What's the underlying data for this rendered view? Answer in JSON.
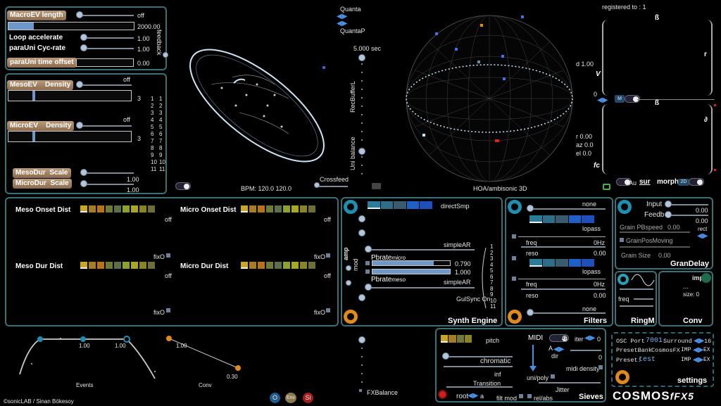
{
  "macro": {
    "length_label": "MacroEV length",
    "length_state": "off",
    "length_value": "2000.00",
    "loop_label": "Loop accelerate",
    "loop_value": "1.00",
    "para_label": "paraUni Cyc-rate",
    "para_value": "1.00",
    "offset_label": "paraUni time offset",
    "offset_value": "0.00",
    "feedback_label": "feedback"
  },
  "meso": {
    "meso_label": "MesoEV",
    "density_label": "Density",
    "meso_state": "off",
    "meso_value": "3",
    "micro_label": "MicroEV",
    "micro_state": "off",
    "micro_value": "3",
    "mesodur_label": "MesoDur",
    "microdur_label": "MicroDur",
    "scale_label": "Scale",
    "mesodur_value": "1.00",
    "microdur_value": "1.00",
    "numbers_a": [
      "1",
      "2",
      "3",
      "4",
      "5",
      "6",
      "7",
      "8",
      "9",
      "10",
      "11"
    ],
    "numbers_b": [
      "1",
      "2",
      "3",
      "4",
      "5",
      "6",
      "7",
      "8",
      "9",
      "10",
      "11"
    ]
  },
  "viz": {
    "bpm_text": "BPM: 120.0  120.0",
    "crossfeed_label": "Crossfeed",
    "quanta_label": "Quanta",
    "quantap_label": "QuantaP",
    "sec_label": "5.000 sec",
    "recbuffer_label": "RecBufferL",
    "unibalance_label": "Uni balance",
    "hoa_label": "HOA/ambisonic 3D"
  },
  "spatial": {
    "registered": "registered to : 1",
    "beta1": "ß",
    "r_label": "r",
    "d_label": "d 1.00",
    "v_label": "V",
    "zero": "0",
    "m_label": "M",
    "beta2": "ß",
    "partial": "∂",
    "r_val": "r 0.00",
    "az_val": "az 0.0",
    "el_val": "el 0.0",
    "fc_label": "fc",
    "au_label": "Au",
    "sur_label": "sur",
    "morph_label": "morph",
    "twod_label": "2D"
  },
  "onset": {
    "meso_onset": "Meso Onset Dist",
    "micro_onset": "Micro Onset Dist",
    "meso_dur": "Meso Dur  Dist",
    "micro_dur": "Micro Dur Dist",
    "off": "off",
    "fixo": "fixO",
    "colors": [
      "#c8a628",
      "#a67c26",
      "#b8721e",
      "#6e7a3a",
      "#5c6e4a",
      "#8ea030",
      "#a6a628",
      "#8a8428",
      "#6e6e3a"
    ]
  },
  "synth": {
    "title": "Synth Engine",
    "directsmp": "directSmp",
    "simplear1": "simpleAR",
    "simplear2": "simpleAR",
    "pbrate_micro": "Pbrate",
    "micro_sub": "micro",
    "pbrate_meso": "Pbrate",
    "meso_sub": "meso",
    "val1": "0.790",
    "val2": "1.000",
    "gulsync": "GulSync On",
    "amp": "amp",
    "mod": "mod",
    "numbers": [
      "1",
      "2",
      "3",
      "4",
      "5",
      "6",
      "7",
      "8",
      "9",
      "10",
      "11"
    ]
  },
  "filters": {
    "title": "Filters",
    "none1": "none",
    "lopass1": "lopass",
    "freq1": "freq",
    "hz1": "0Hz",
    "reso1": "reso",
    "reso1_val": "0.00",
    "lopass2": "lopass",
    "freq2": "freq",
    "hz2": "0Hz",
    "reso2": "reso",
    "reso2_val": "0.00",
    "none2": "none"
  },
  "grandelay": {
    "title": "GranDelay",
    "input": "Input",
    "input_val": "0.00",
    "feedb": "Feedb",
    "feedb_val": "0.00",
    "grainpb": "Grain PBspeed",
    "grainpb_val": "0.00",
    "rect": "rect",
    "grainpos": "GrainPosMoving",
    "grainsize": "Grain Size",
    "grainsize_val": "0.00"
  },
  "ringm": {
    "title": "RingM",
    "freq": "freq"
  },
  "conv": {
    "title": "Conv",
    "imp": "imp",
    "dots": "...",
    "size": "size: 0"
  },
  "pitch": {
    "pitch_label": "pitch",
    "chromatic": "chromatic",
    "inf": "inf",
    "transition": "Transition",
    "root": "root",
    "root_val": "a",
    "filtmod": "filt mod",
    "relabs": "rel/abs",
    "midi": "MIDI",
    "arp": "arp",
    "iter": "iter",
    "iter_val": "0",
    "a_label": "A",
    "dir_label": "dir",
    "dir_val": "0",
    "mididensity": "midi density",
    "unipoly": "uni/poly",
    "jitter": "Jitter",
    "sieves": "Sieves"
  },
  "settings": {
    "osc_label": "OSC Port",
    "osc_port": "7001",
    "surround_label": "Surround",
    "surround_val": "16",
    "presetbank_label": "PresetBank",
    "presetbank_val": "CosmosFX",
    "imp1": "IMP",
    "ex1": "EX",
    "preset_label": "Preset:",
    "preset_val": "test",
    "imp2": "IMP",
    "ex2": "EX",
    "title": "settings"
  },
  "env": {
    "events_label": "Events",
    "conv_label": "Conv",
    "v1": "1.00",
    "v2": "1.00",
    "v3": "1.00",
    "v4": "0.30"
  },
  "footer": {
    "credit": "©sonicLAB / Sinan Bökesoy",
    "btn_o": "O",
    "btn_env": "Env",
    "btn_si": "Si",
    "fxbalance": "FXBalance",
    "logo": "COSMOS",
    "logo_fx": "fFX5"
  }
}
